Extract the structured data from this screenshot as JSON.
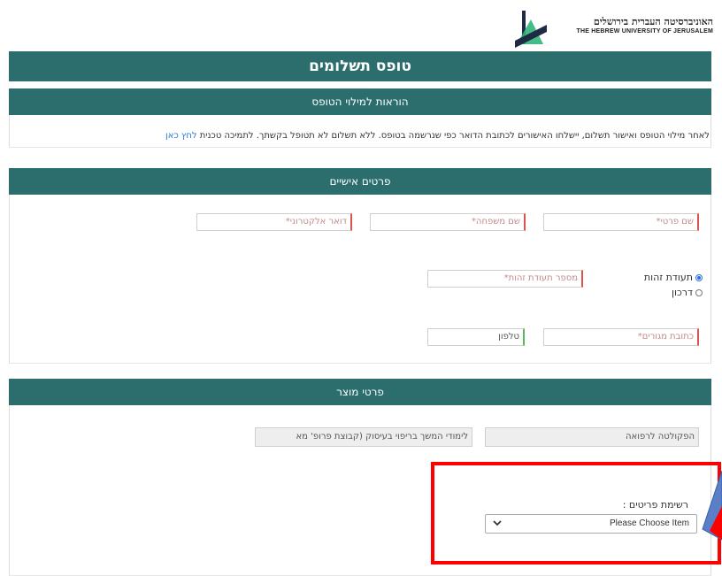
{
  "header": {
    "logo_hebrew": "האוניברסיטה העברית בירושלים",
    "logo_english": "THE HEBREW UNIVERSITY OF JERUSALEM",
    "logo_icon": "hebrew-university-logo"
  },
  "form": {
    "title": "טופס תשלומים",
    "instructions_header": "הוראות למילוי הטופס",
    "instructions_text": "לאחר מילוי הטופס ואישור תשלום, יישלחו האישורים לכתובת הדואר כפי שנרשמה בטופס. ללא תשלום לא תטופל בקשתך. לתמיכה טכנית",
    "instructions_link": "לחץ כאן"
  },
  "personal": {
    "header": "פרטים אישיים",
    "first_name_placeholder": "שם פרטי*",
    "last_name_placeholder": "שם משפחה*",
    "email_placeholder": "דואר אלקטרוני*",
    "id_options": [
      "תעודת זהות",
      "דרכון"
    ],
    "id_selected": "תעודת זהות",
    "id_number_placeholder": "מספר תעודת זהות*",
    "address_placeholder": "כתובת מגורים*",
    "phone_placeholder": "טלפון"
  },
  "product": {
    "header": "פרטי מוצר",
    "faculty_value": "הפקולטה לרפואה",
    "program_value": "לימודי המשך בריפוי בעיסוק (קבוצת פרופ' מא",
    "items_label": "רשימת פריטים :",
    "items_select_value": "Please Choose Item"
  },
  "colors": {
    "header_bar": "#2c6e6e",
    "required_border": "#d9534f",
    "highlight_box": "#ff0000",
    "link": "#2a7ad3"
  }
}
